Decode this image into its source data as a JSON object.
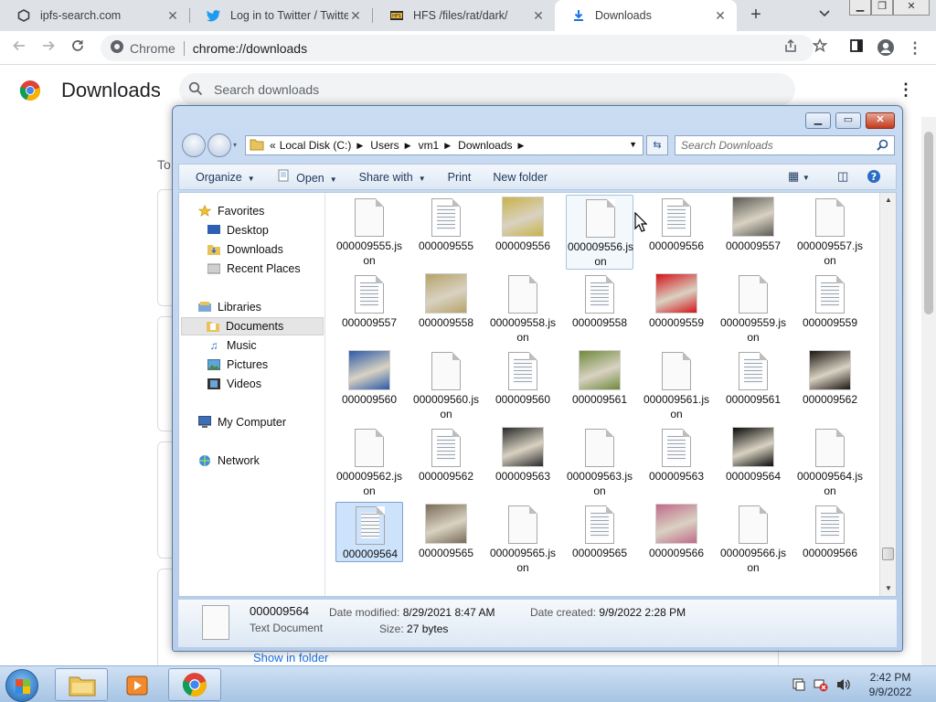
{
  "browser": {
    "tabs": [
      {
        "title": "ipfs-search.com",
        "icon": "ipfs-icon"
      },
      {
        "title": "Log in to Twitter / Twitter",
        "icon": "twitter-bird-icon"
      },
      {
        "title": "HFS /files/rat/dark/",
        "icon": "hfs-icon"
      },
      {
        "title": "Downloads",
        "icon": "download-arrow-icon",
        "active": true
      }
    ],
    "close_glyph": "✕",
    "newtab_glyph": "+",
    "omnibox": {
      "chip": "Chrome",
      "url": "chrome://downloads"
    }
  },
  "downloads_page": {
    "title": "Downloads",
    "search_placeholder": "Search downloads",
    "section_label": "To",
    "show_in_folder": "Show in folder"
  },
  "explorer": {
    "breadcrumb": [
      "Local Disk (C:)",
      "Users",
      "vm1",
      "Downloads"
    ],
    "breadcrumb_prefix": "«",
    "search_placeholder": "Search Downloads",
    "commands": [
      "Organize",
      "Open",
      "Share with",
      "Print",
      "New folder"
    ],
    "nav": {
      "favorites": {
        "label": "Favorites",
        "items": [
          "Desktop",
          "Downloads",
          "Recent Places"
        ]
      },
      "libraries": {
        "label": "Libraries",
        "items": [
          "Documents",
          "Music",
          "Pictures",
          "Videos"
        ]
      },
      "computer": "My Computer",
      "network": "Network",
      "selected": "Documents"
    },
    "files": [
      {
        "name": "000009555.json",
        "kind": "blank"
      },
      {
        "name": "000009555",
        "kind": "text"
      },
      {
        "name": "000009556",
        "kind": "image",
        "color": "#c9b24a"
      },
      {
        "name": "000009556.json",
        "kind": "blank",
        "state": "hover"
      },
      {
        "name": "000009556",
        "kind": "text"
      },
      {
        "name": "000009557",
        "kind": "image",
        "color": "#5a5a55"
      },
      {
        "name": "000009557.json",
        "kind": "blank"
      },
      {
        "name": "000009557",
        "kind": "text"
      },
      {
        "name": "000009558",
        "kind": "image",
        "color": "#b6a36a"
      },
      {
        "name": "000009558.json",
        "kind": "blank"
      },
      {
        "name": "000009558",
        "kind": "text"
      },
      {
        "name": "000009559",
        "kind": "image",
        "color": "#d4141a"
      },
      {
        "name": "000009559.json",
        "kind": "blank"
      },
      {
        "name": "000009559",
        "kind": "text"
      },
      {
        "name": "000009560",
        "kind": "image",
        "color": "#2b5aa8"
      },
      {
        "name": "000009560.json",
        "kind": "blank"
      },
      {
        "name": "000009560",
        "kind": "text"
      },
      {
        "name": "000009561",
        "kind": "image",
        "color": "#6e8a3a"
      },
      {
        "name": "000009561.json",
        "kind": "blank"
      },
      {
        "name": "000009561",
        "kind": "text"
      },
      {
        "name": "000009562",
        "kind": "image",
        "color": "#1a1512"
      },
      {
        "name": "000009562.json",
        "kind": "blank"
      },
      {
        "name": "000009562",
        "kind": "text"
      },
      {
        "name": "000009563",
        "kind": "image",
        "color": "#2a2a2a"
      },
      {
        "name": "000009563.json",
        "kind": "blank"
      },
      {
        "name": "000009563",
        "kind": "text"
      },
      {
        "name": "000009564",
        "kind": "image",
        "color": "#0b0b0b"
      },
      {
        "name": "000009564.json",
        "kind": "blank"
      },
      {
        "name": "000009564",
        "kind": "text",
        "state": "selected"
      },
      {
        "name": "000009565",
        "kind": "image",
        "color": "#7a6b58"
      },
      {
        "name": "000009565.json",
        "kind": "blank"
      },
      {
        "name": "000009565",
        "kind": "text"
      },
      {
        "name": "000009566",
        "kind": "image",
        "color": "#c06a8a"
      },
      {
        "name": "000009566.json",
        "kind": "blank"
      },
      {
        "name": "000009566",
        "kind": "text"
      }
    ],
    "details": {
      "name": "000009564",
      "type": "Text Document",
      "modified_label": "Date modified:",
      "modified": "8/29/2021 8:47 AM",
      "created_label": "Date created:",
      "created": "9/9/2022 2:28 PM",
      "size_label": "Size:",
      "size": "27 bytes"
    }
  },
  "taskbar": {
    "time": "2:42 PM",
    "date": "9/9/2022"
  }
}
